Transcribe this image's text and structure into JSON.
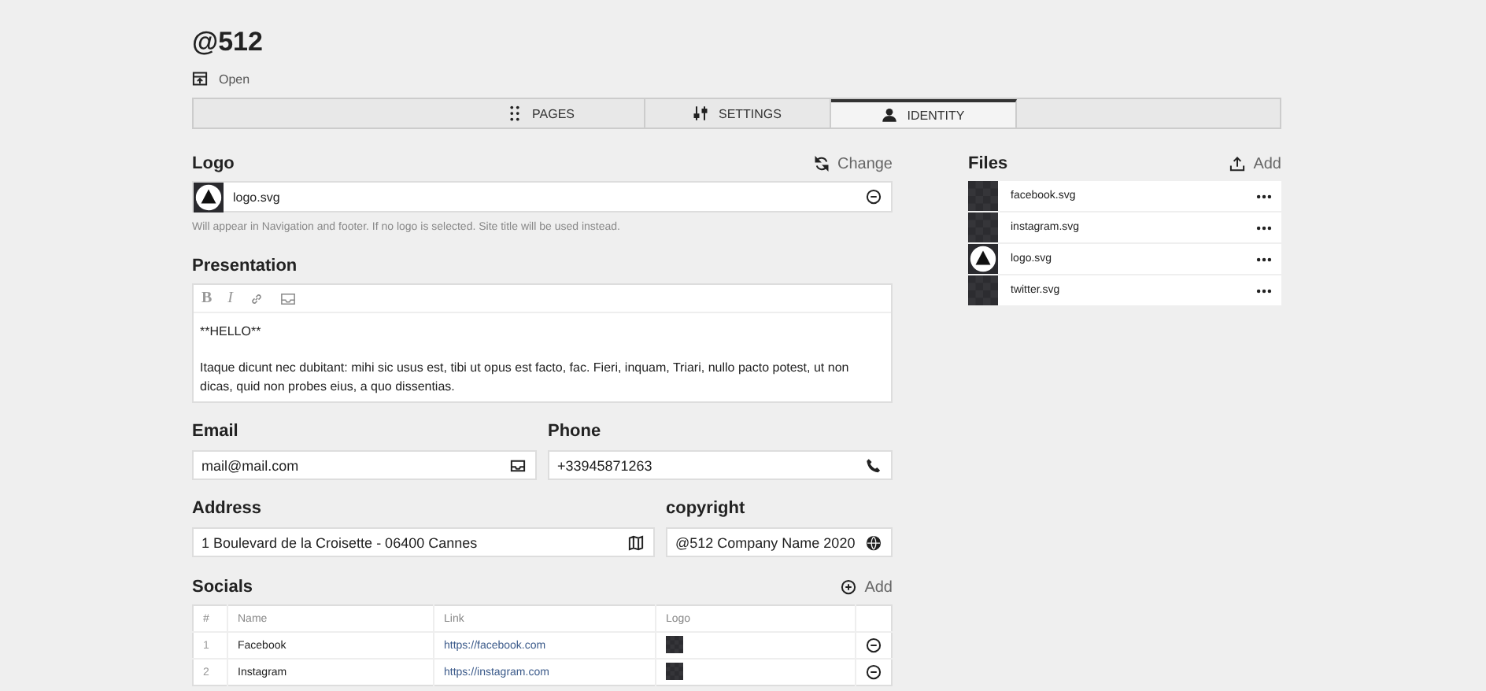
{
  "header": {
    "title": "@512",
    "open_label": "Open"
  },
  "tabs": [
    {
      "label": "PAGES",
      "selected": false
    },
    {
      "label": "SETTINGS",
      "selected": false
    },
    {
      "label": "IDENTITY",
      "selected": true
    }
  ],
  "logo": {
    "label": "Logo",
    "action": "Change",
    "file": "logo.svg",
    "help": "Will appear in Navigation and footer. If no logo is selected. Site title will be used instead."
  },
  "presentation": {
    "label": "Presentation",
    "toolbar": [
      {
        "kind": "bold",
        "label": "B"
      },
      {
        "kind": "italic",
        "label": "I"
      },
      {
        "kind": "link"
      },
      {
        "kind": "email"
      }
    ],
    "paragraphs": [
      "**HELLO**",
      "Itaque dicunt nec dubitant: mihi sic usus est, tibi ut opus est facto, fac. Fieri, inquam, Triari, nullo pacto potest, ut non dicas, quid non probes eius, a quo dissentias."
    ]
  },
  "fields": [
    [
      {
        "label": "Email",
        "value": "mail@mail.com"
      },
      {
        "label": "Phone",
        "value": "+33945871263"
      }
    ],
    [
      {
        "label": "Address",
        "value": "1 Boulevard de la Croisette - 06400 Cannes"
      },
      {
        "label": "copyright",
        "value": "@512 Company Name 2020"
      }
    ]
  ],
  "socials": {
    "label": "Socials",
    "action": "Add",
    "columns": [
      "#",
      "Name",
      "Link",
      "Logo"
    ],
    "rows": [
      {
        "index": "1",
        "name": "Facebook",
        "link": "https://facebook.com"
      },
      {
        "index": "2",
        "name": "Instagram",
        "link": "https://instagram.com"
      }
    ]
  },
  "files": {
    "label": "Files",
    "action": "Add",
    "items": [
      {
        "name": "facebook.svg",
        "kind": "image"
      },
      {
        "name": "instagram.svg",
        "kind": "image"
      },
      {
        "name": "logo.svg",
        "kind": "logo"
      },
      {
        "name": "twitter.svg",
        "kind": "image"
      }
    ]
  }
}
